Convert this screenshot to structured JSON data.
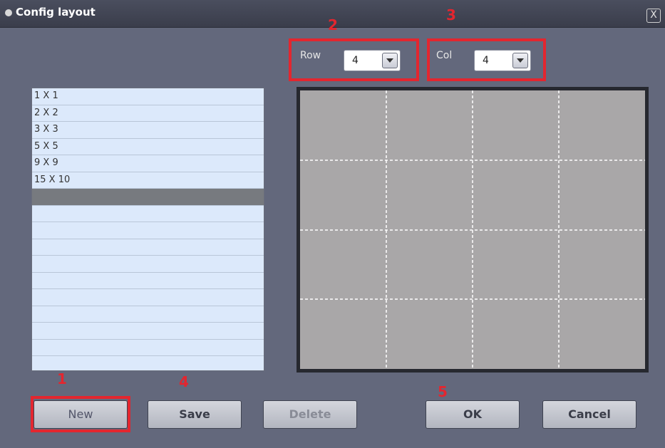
{
  "window": {
    "title": "Config layout",
    "close_label": "X"
  },
  "row": {
    "label": "Row",
    "value": "4"
  },
  "col": {
    "label": "Col",
    "value": "4"
  },
  "layouts": [
    "1 X 1",
    "2 X 2",
    "3 X 3",
    "5 X 5",
    "9 X 9",
    "15 X 10"
  ],
  "selected_index": 6,
  "preview": {
    "rows": 4,
    "cols": 4
  },
  "buttons": {
    "new": "New",
    "save": "Save",
    "delete": "Delete",
    "ok": "OK",
    "cancel": "Cancel"
  },
  "callouts": [
    "1",
    "2",
    "3",
    "4",
    "5"
  ],
  "colors": {
    "callout": "#e3262f",
    "background": "#63687c",
    "list": "#dce9fb",
    "preview": "#a9a7a8"
  }
}
